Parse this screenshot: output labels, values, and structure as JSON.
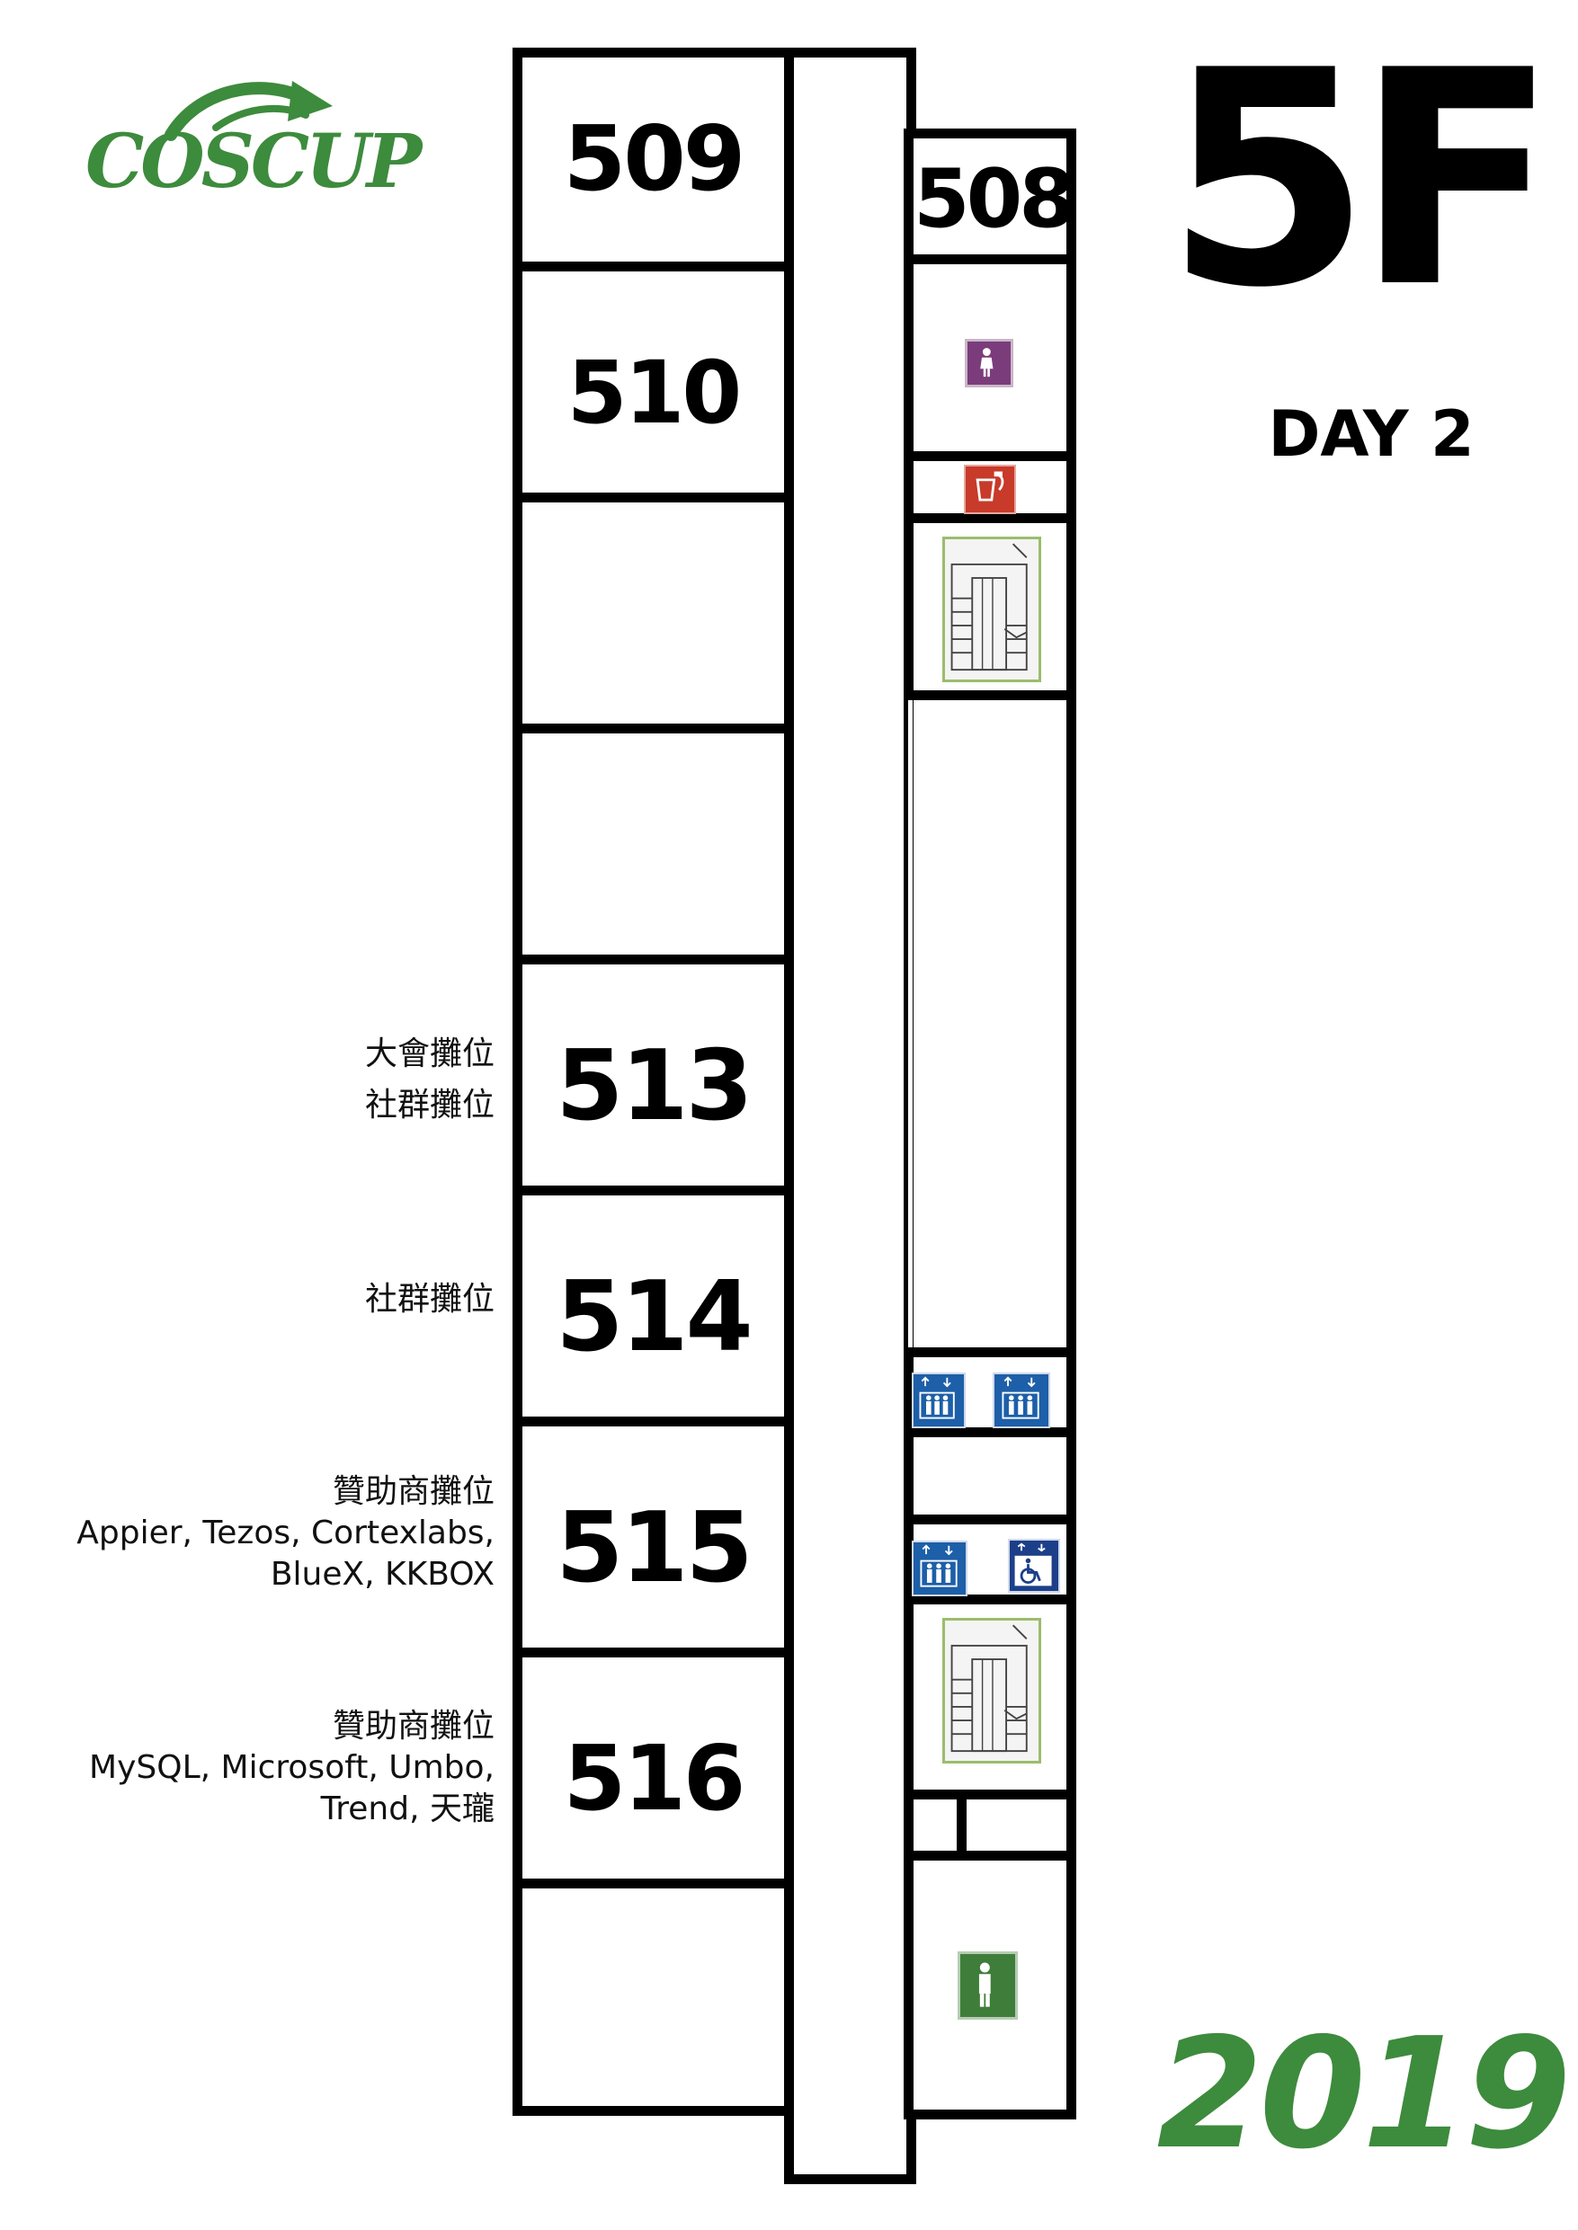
{
  "header": {
    "logo_text": "COSCUP",
    "floor": "5F",
    "day": "DAY 2",
    "year": "2019"
  },
  "rooms": {
    "r509": "509",
    "r508": "508",
    "r510": "510",
    "r513": "513",
    "r514": "514",
    "r515": "515",
    "r516": "516"
  },
  "labels": {
    "r513_line1": "大會攤位",
    "r513_line2": "社群攤位",
    "r514_line1": "社群攤位",
    "r515_line1": "贊助商攤位",
    "r515_line2": "Appier, Tezos, Cortexlabs,",
    "r515_line3": "BlueX, KKBOX",
    "r516_line1": "贊助商攤位",
    "r516_line2": "MySQL, Microsoft, Umbo,",
    "r516_line3": "Trend, 天瓏"
  },
  "icons": [
    "female-restroom-icon",
    "drinking-water-icon",
    "stairs-icon",
    "elevator-icon",
    "elevator-icon",
    "elevator-icon",
    "accessible-elevator-icon",
    "stairs-icon",
    "male-restroom-icon"
  ],
  "colors": {
    "brand_green": "#3d8b3d",
    "female_purple": "#7b3c7b",
    "water_red": "#c83a2a",
    "elevator_blue": "#1d5fa8",
    "male_green": "#3f7d3a"
  }
}
